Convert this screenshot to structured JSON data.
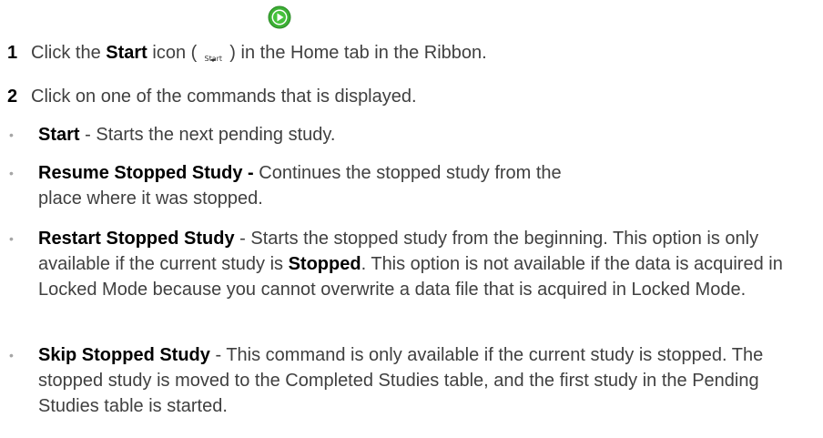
{
  "steps": [
    {
      "number": "1",
      "text_before": "Click the ",
      "bold": "Start",
      "text_mid": " icon (",
      "icon_caption": "Start",
      "icon": "start-play-icon",
      "text_after": ") in the Home tab in the Ribbon."
    },
    {
      "number": "2",
      "text": "Click on one of the commands that is displayed."
    }
  ],
  "bullets": [
    {
      "bold": "Start",
      "text": " - Starts the next pending study."
    },
    {
      "bold": "Resume Stopped Study -",
      "text": " Continues the stopped study from the place where it was stopped."
    },
    {
      "bold": "Restart Stopped Study",
      "text": " - Starts the stopped study from the beginning. This option is only available if the current study is ",
      "bold2": "Stopped",
      "text2": ". This option is not available if the data is acquired in Locked Mode because you cannot overwrite a data file that is acquired in Locked Mode."
    },
    {
      "bold": "Skip Stopped Study",
      "text": " - This command is only available if the current study is stopped. The stopped study is moved to the Completed Studies table, and the first study in the Pending Studies table is started."
    }
  ],
  "bullet_glyph": "•",
  "colors": {
    "text": "#404040",
    "bold": "#000000",
    "bullet": "#a6a6a6",
    "play_green": "#3cb034"
  }
}
